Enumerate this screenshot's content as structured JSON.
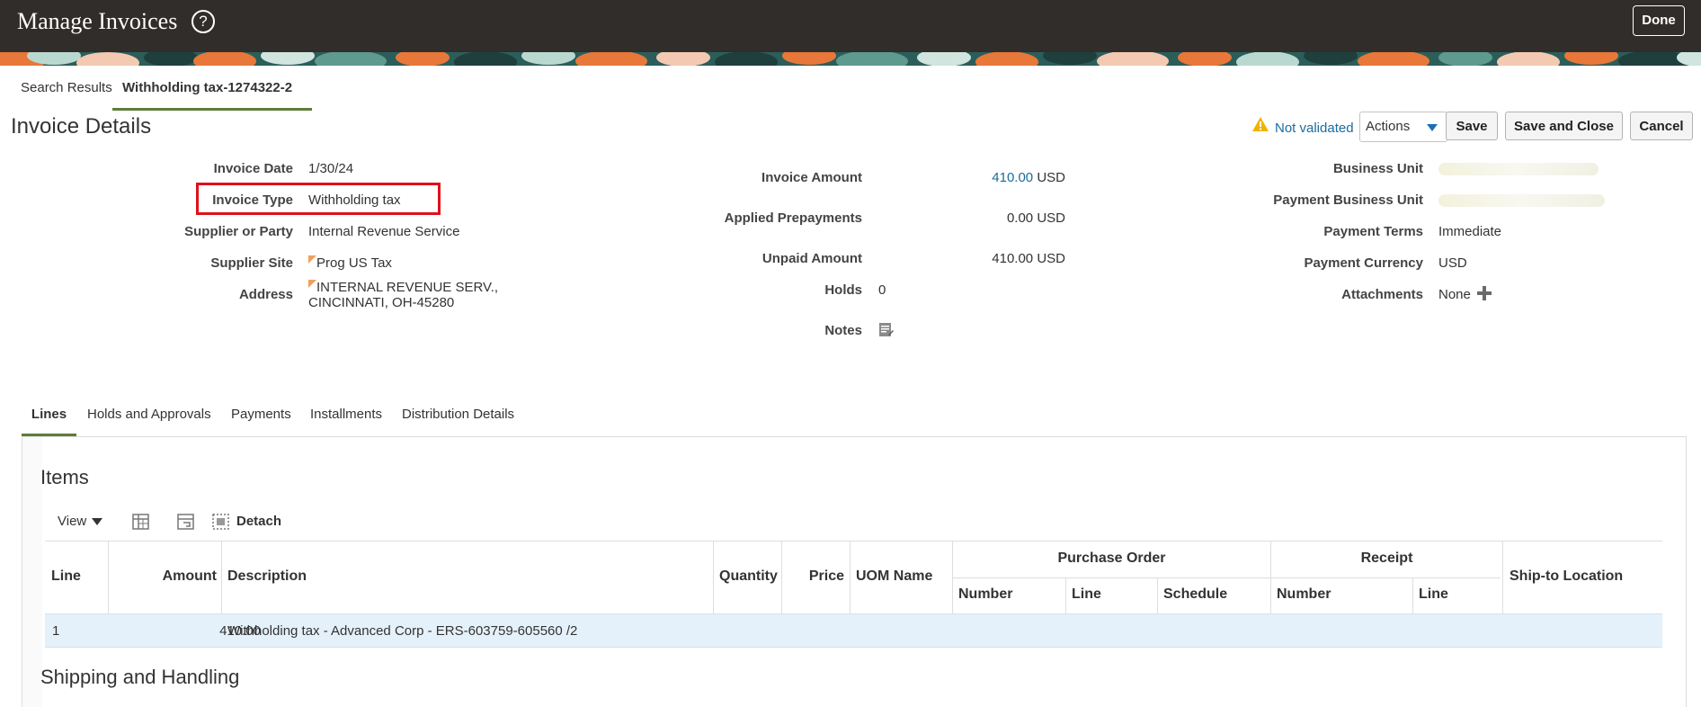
{
  "header": {
    "app_title": "Manage Invoices",
    "help_icon": "question-circle-icon",
    "done_label": "Done"
  },
  "page_tabs": [
    {
      "label": "Search Results",
      "active": false
    },
    {
      "label": "Withholding tax-1274322-2",
      "active": true
    }
  ],
  "page_title": "Invoice Details",
  "toolbar": {
    "status_icon": "warning-icon",
    "status_text": "Not validated",
    "actions_label": "Actions",
    "save_label": "Save",
    "save_close_label": "Save and Close",
    "cancel_label": "Cancel"
  },
  "details_left": {
    "invoice_date_label": "Invoice Date",
    "invoice_date": "1/30/24",
    "invoice_type_label": "Invoice Type",
    "invoice_type": "Withholding tax",
    "supplier_label": "Supplier or Party",
    "supplier": "Internal Revenue Service",
    "supplier_site_label": "Supplier Site",
    "supplier_site": "Prog US Tax",
    "address_label": "Address",
    "address_line1": "INTERNAL REVENUE SERV.,",
    "address_line2": "CINCINNATI, OH-45280"
  },
  "details_middle": {
    "invoice_amount_label": "Invoice Amount",
    "invoice_amount": "410.00",
    "invoice_amount_currency": "USD",
    "applied_prepayments_label": "Applied Prepayments",
    "applied_prepayments": "0.00",
    "applied_prepayments_currency": "USD",
    "unpaid_amount_label": "Unpaid Amount",
    "unpaid_amount": "410.00",
    "unpaid_amount_currency": "USD",
    "holds_label": "Holds",
    "holds": "0",
    "notes_label": "Notes",
    "notes_icon": "notes-icon"
  },
  "details_right": {
    "business_unit_label": "Business Unit",
    "payment_business_unit_label": "Payment Business Unit",
    "payment_terms_label": "Payment Terms",
    "payment_terms": "Immediate",
    "payment_currency_label": "Payment Currency",
    "payment_currency": "USD",
    "attachments_label": "Attachments",
    "attachments": "None",
    "add_icon": "plus-icon"
  },
  "lower_tabs": [
    {
      "label": "Lines",
      "active": true
    },
    {
      "label": "Holds and Approvals",
      "active": false
    },
    {
      "label": "Payments",
      "active": false
    },
    {
      "label": "Installments",
      "active": false
    },
    {
      "label": "Distribution Details",
      "active": false
    }
  ],
  "items": {
    "title": "Items",
    "view_label": "View",
    "detach_label": "Detach",
    "columns": {
      "line": "Line",
      "amount": "Amount",
      "description": "Description",
      "quantity": "Quantity",
      "price": "Price",
      "uom": "UOM Name",
      "purchase_order": "Purchase Order",
      "po_number": "Number",
      "po_line": "Line",
      "po_schedule": "Schedule",
      "receipt": "Receipt",
      "receipt_number": "Number",
      "receipt_line": "Line",
      "ship_to": "Ship-to Location"
    },
    "rows": [
      {
        "line": "1",
        "amount": "410.00",
        "description": "Withholding tax - Advanced Corp - ERS-603759-605560 /2"
      }
    ]
  },
  "shipping_title": "Shipping and Handling",
  "colors": {
    "header_bg": "#312d2a",
    "link": "#1c6b9c",
    "tab_underline": "#5d7c3b",
    "highlight_box": "#e0101a",
    "selected_row": "#e5f1fa"
  }
}
